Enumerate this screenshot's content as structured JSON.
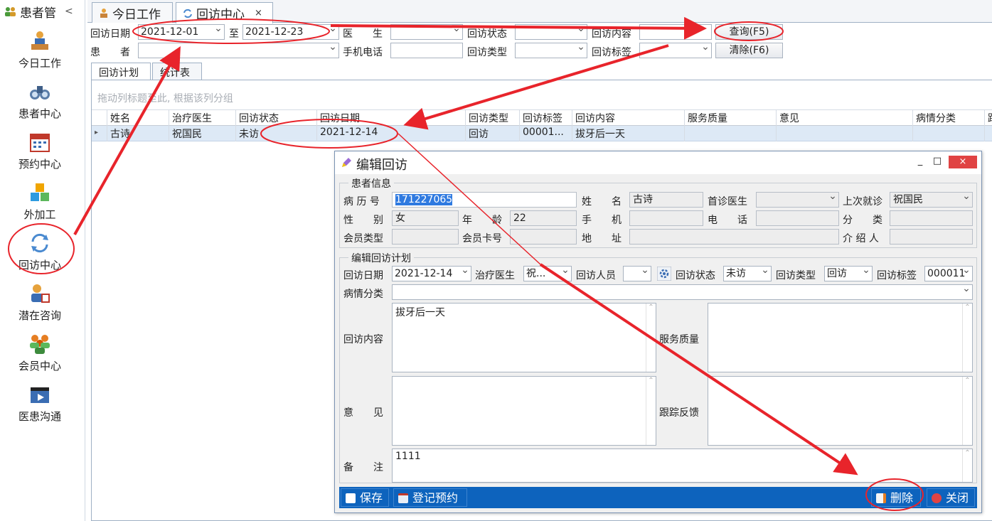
{
  "sidebar": {
    "title": "患者管",
    "collapse_icon": "chevron-left-icon",
    "items": [
      {
        "label": "今日工作",
        "icon": "doctor-desk-icon"
      },
      {
        "label": "患者中心",
        "icon": "binoculars-icon"
      },
      {
        "label": "预约中心",
        "icon": "calendar-icon"
      },
      {
        "label": "外加工",
        "icon": "cubes-icon"
      },
      {
        "label": "回访中心",
        "icon": "refresh-icon"
      },
      {
        "label": "潜在咨询",
        "icon": "consultant-icon"
      },
      {
        "label": "会员中心",
        "icon": "members-icon"
      },
      {
        "label": "医患沟通",
        "icon": "video-icon"
      }
    ]
  },
  "tabs": [
    {
      "label": "今日工作",
      "icon": "doctor-icon"
    },
    {
      "label": "回访中心",
      "icon": "refresh-icon",
      "close": "×"
    }
  ],
  "filters": {
    "visit_date_label": "回访日期",
    "date_from": "2021-12-01",
    "to_label": "至",
    "date_to": "2021-12-23",
    "doctor_label": "医　　生",
    "doctor_value": "",
    "status_label": "回访状态",
    "status_value": "",
    "content_label": "回访内容",
    "content_value": "",
    "query_button": "查询(F5)",
    "patient_label": "患　　者",
    "patient_value": "",
    "phone_label": "手机电话",
    "phone_value": "",
    "type_label": "回访类型",
    "type_value": "",
    "tag_label": "回访标签",
    "tag_value": "",
    "clear_button": "清除(F6)"
  },
  "subtabs": [
    "回访计划",
    "统计表"
  ],
  "grid": {
    "group_hint": "拖动列标题至此, 根据该列分组",
    "columns": [
      "姓名",
      "治疗医生",
      "回访状态",
      "回访日期",
      "回访类型",
      "回访标签",
      "回访内容",
      "服务质量",
      "意见",
      "病情分类",
      "跟"
    ],
    "rows": [
      {
        "indicator": "▸",
        "cells": [
          "古诗",
          "祝国民",
          "未访",
          "2021-12-14",
          "回访",
          "00001...",
          "拔牙后一天",
          "",
          "",
          "",
          ""
        ]
      }
    ]
  },
  "dialog": {
    "title": "编辑回访",
    "minimize": "_",
    "maximize": "□",
    "close": "×",
    "patient_section": "患者信息",
    "patient_fields": {
      "record_no_label": "病 历 号",
      "record_no": "171227065",
      "name_label": "姓　　名",
      "name": "古诗",
      "first_doctor_label": "首诊医生",
      "first_doctor": "",
      "last_visit_label": "上次就诊",
      "last_visit": "祝国民",
      "gender_label": "性　　别",
      "gender": "女",
      "age_label": "年　　龄",
      "age": "22",
      "mobile_label": "手　　机",
      "mobile": "",
      "tel_label": "电　　话",
      "tel": "",
      "category_label": "分　　类",
      "category": "",
      "member_type_label": "会员类型",
      "member_type": "",
      "member_card_label": "会员卡号",
      "member_card": "",
      "address_label": "地　　址",
      "address": "",
      "referrer_label": "介 绍 人",
      "referrer": ""
    },
    "plan_section": "编辑回访计划",
    "plan_fields": {
      "date_label": "回访日期",
      "date": "2021-12-14",
      "doctor_label": "治疗医生",
      "doctor": "祝...",
      "staff_label": "回访人员",
      "staff": "",
      "status_label": "回访状态",
      "status": "未访",
      "type_label": "回访类型",
      "type": "回访",
      "tag_label": "回访标签",
      "tag": "000011",
      "condition_label": "病情分类",
      "condition": "",
      "content_label": "回访内容",
      "content": "拔牙后一天",
      "quality_label": "服务质量",
      "quality": "",
      "opinion_label": "意　　见",
      "opinion": "",
      "feedback_label": "跟踪反馈",
      "feedback": "",
      "remark_label": "备　　注",
      "remark": "1111"
    },
    "footer": {
      "save": "保存",
      "register": "登记预约",
      "delete": "删除",
      "close": "关闭"
    }
  },
  "colors": {
    "annotation": "#e8242b",
    "footer": "#0d63bd",
    "selected_row": "#dde9f6"
  }
}
